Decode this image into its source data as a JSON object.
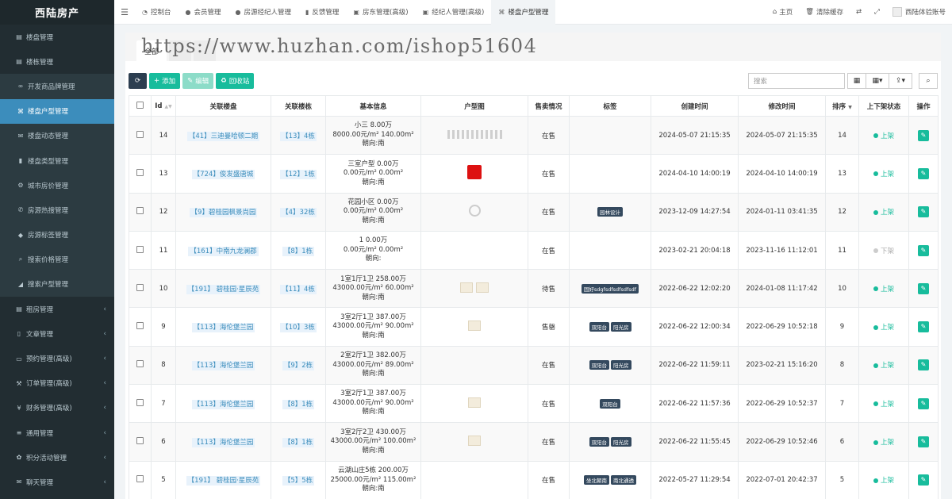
{
  "brand": "西陆房产",
  "sidebar": {
    "items": [
      {
        "label": "楼盘管理",
        "icon": "building-icon",
        "sub": false,
        "active": false,
        "caret": false
      },
      {
        "label": "楼栋管理",
        "icon": "building-icon",
        "sub": false,
        "active": false,
        "caret": false
      },
      {
        "label": "开发商品牌管理",
        "icon": "link-icon",
        "sub": true,
        "active": false,
        "caret": false
      },
      {
        "label": "楼盘户型管理",
        "icon": "sitemap-icon",
        "sub": true,
        "active": true,
        "caret": false
      },
      {
        "label": "楼盘动态管理",
        "icon": "comments-icon",
        "sub": true,
        "active": false,
        "caret": false
      },
      {
        "label": "楼盘类型管理",
        "icon": "book-icon",
        "sub": true,
        "active": false,
        "caret": false
      },
      {
        "label": "城市房价管理",
        "icon": "gear-icon",
        "sub": true,
        "active": false,
        "caret": false
      },
      {
        "label": "房源热搜管理",
        "icon": "bullhorn-icon",
        "sub": true,
        "active": false,
        "caret": false
      },
      {
        "label": "房源标签管理",
        "icon": "tags-icon",
        "sub": true,
        "active": false,
        "caret": false
      },
      {
        "label": "搜索价格管理",
        "icon": "search-icon",
        "sub": true,
        "active": false,
        "caret": false
      },
      {
        "label": "搜索户型管理",
        "icon": "chart-icon",
        "sub": true,
        "active": false,
        "caret": false
      },
      {
        "label": "租房管理",
        "icon": "building-icon",
        "sub": false,
        "active": false,
        "caret": true
      },
      {
        "label": "文章管理",
        "icon": "file-icon",
        "sub": false,
        "active": false,
        "caret": true
      },
      {
        "label": "预约管理(高级)",
        "icon": "monitor-icon",
        "sub": false,
        "active": false,
        "caret": true
      },
      {
        "label": "订单管理(高级)",
        "icon": "gavel-icon",
        "sub": false,
        "active": false,
        "caret": true
      },
      {
        "label": "财务管理(高级)",
        "icon": "yen-icon",
        "sub": false,
        "active": false,
        "caret": true
      },
      {
        "label": "通用管理",
        "icon": "list-icon",
        "sub": false,
        "active": false,
        "caret": true
      },
      {
        "label": "积分活动管理",
        "icon": "gift-icon",
        "sub": false,
        "active": false,
        "caret": true
      },
      {
        "label": "聊天管理",
        "icon": "chat-icon",
        "sub": false,
        "active": false,
        "caret": true
      }
    ]
  },
  "topnav": {
    "tabs": [
      {
        "label": "控制台",
        "icon": "dashboard-icon",
        "active": false
      },
      {
        "label": "会员管理",
        "icon": "user-icon",
        "active": false
      },
      {
        "label": "房源经纪人管理",
        "icon": "user-icon",
        "active": false
      },
      {
        "label": "反馈管理",
        "icon": "book-icon",
        "active": false
      },
      {
        "label": "房东管理(高级)",
        "icon": "lock-icon",
        "active": false
      },
      {
        "label": "经纪人管理(高级)",
        "icon": "lock-icon",
        "active": false
      },
      {
        "label": "楼盘户型管理",
        "icon": "sitemap-icon",
        "active": true
      }
    ],
    "home": "主页",
    "clear_cache": "清除缓存",
    "user": "西陆体验账号"
  },
  "watermark": "https://www.huzhan.com/ishop51604",
  "subtabs": [
    "全部",
    "",
    ""
  ],
  "toolbar": {
    "add": "添加",
    "edit": "编辑",
    "trash": "回收站",
    "search_placeholder": "搜索"
  },
  "table": {
    "headers": {
      "id": "Id",
      "loupan": "关联楼盘",
      "loudong": "关联楼栋",
      "info": "基本信息",
      "image": "户型图",
      "sale": "售卖情况",
      "tags": "标签",
      "created": "创建时间",
      "updated": "修改时间",
      "weigh": "排序",
      "status": "上下架状态",
      "op": "操作"
    },
    "rows": [
      {
        "id": "14",
        "loupan": "【41】三迪曼哈顿二期",
        "loudong": "【13】4栋",
        "info1": "小三 8.00万",
        "info2": "8000.00元/m² 140.00m²",
        "info3": "朝向:南",
        "image": "strip",
        "sale": "在售",
        "sale_color": "normal",
        "tags": [],
        "created": "2024-05-07 21:15:35",
        "updated": "2024-05-07 21:15:35",
        "weigh": "14",
        "status": "上架",
        "status_on": true
      },
      {
        "id": "13",
        "loupan": "【724】俊发盛唐城",
        "loudong": "【12】1栋",
        "info1": "三室户型 0.00万",
        "info2": "0.00元/m² 0.00m²",
        "info3": "朝向:南",
        "image": "red",
        "sale": "在售",
        "sale_color": "normal",
        "tags": [],
        "created": "2024-04-10 14:00:19",
        "updated": "2024-04-10 14:00:19",
        "weigh": "13",
        "status": "上架",
        "status_on": true
      },
      {
        "id": "12",
        "loupan": "【9】碧桂园枫景尚园",
        "loudong": "【4】32栋",
        "info1": "花园小区 0.00万",
        "info2": "0.00元/m² 0.00m²",
        "info3": "朝向:南",
        "image": "ring",
        "sale": "在售",
        "sale_color": "normal",
        "tags": [
          "园林设计"
        ],
        "created": "2023-12-09 14:27:54",
        "updated": "2024-01-11 03:41:35",
        "weigh": "12",
        "status": "上架",
        "status_on": true
      },
      {
        "id": "11",
        "loupan": "【161】中南九龙澜郡",
        "loudong": "【8】1栋",
        "info1": "1 0.00万",
        "info2": "0.00元/m² 0.00m²",
        "info3": "朝向:",
        "image": "none",
        "sale": "在售",
        "sale_color": "normal",
        "tags": [],
        "created": "2023-02-21 20:04:18",
        "updated": "2023-11-16 11:12:01",
        "weigh": "11",
        "status": "下架",
        "status_on": false
      },
      {
        "id": "10",
        "loupan": "【191】 碧桂园·星辰苑",
        "loudong": "【11】4栋",
        "info1": "1室1厅1卫 258.00万",
        "info2": "43000.00元/m² 60.00m²",
        "info3": "朝向:南",
        "image": "double",
        "sale": "待售",
        "sale_color": "red",
        "tags": [
          "固好sdgfsdfsdfsdfsdf"
        ],
        "created": "2022-06-22 12:02:20",
        "updated": "2024-01-08 11:17:42",
        "weigh": "10",
        "status": "上架",
        "status_on": true
      },
      {
        "id": "9",
        "loupan": "【113】海伦堡兰园",
        "loudong": "【10】3栋",
        "info1": "3室2厅1卫 387.00万",
        "info2": "43000.00元/m² 90.00m²",
        "info3": "朝向:南",
        "image": "single",
        "sale": "售罄",
        "sale_color": "green",
        "tags": [
          "双阳台",
          "阳光房"
        ],
        "created": "2022-06-22 12:00:34",
        "updated": "2022-06-29 10:52:18",
        "weigh": "9",
        "status": "上架",
        "status_on": true
      },
      {
        "id": "8",
        "loupan": "【113】海伦堡兰园",
        "loudong": "【9】2栋",
        "info1": "2室2厅1卫 382.00万",
        "info2": "43000.00元/m² 89.00m²",
        "info3": "朝向:南",
        "image": "none",
        "sale": "在售",
        "sale_color": "normal",
        "tags": [
          "双阳台",
          "阳光房"
        ],
        "created": "2022-06-22 11:59:11",
        "updated": "2023-02-21 15:16:20",
        "weigh": "8",
        "status": "上架",
        "status_on": true
      },
      {
        "id": "7",
        "loupan": "【113】海伦堡兰园",
        "loudong": "【8】1栋",
        "info1": "3室2厅1卫 387.00万",
        "info2": "43000.00元/m² 90.00m²",
        "info3": "朝向:南",
        "image": "single",
        "sale": "在售",
        "sale_color": "normal",
        "tags": [
          "双阳台"
        ],
        "created": "2022-06-22 11:57:36",
        "updated": "2022-06-29 10:52:37",
        "weigh": "7",
        "status": "上架",
        "status_on": true
      },
      {
        "id": "6",
        "loupan": "【113】海伦堡兰园",
        "loudong": "【8】1栋",
        "info1": "3室2厅2卫 430.00万",
        "info2": "43000.00元/m² 100.00m²",
        "info3": "朝向:南",
        "image": "single",
        "sale": "在售",
        "sale_color": "normal",
        "tags": [
          "双阳台",
          "阳光房"
        ],
        "created": "2022-06-22 11:55:45",
        "updated": "2022-06-29 10:52:46",
        "weigh": "6",
        "status": "上架",
        "status_on": true
      },
      {
        "id": "5",
        "loupan": "【191】 碧桂园·星辰苑",
        "loudong": "【5】5栋",
        "info1": "云湖山庄5栋 200.00万",
        "info2": "25000.00元/m² 115.00m²",
        "info3": "朝向:南",
        "image": "none",
        "sale": "在售",
        "sale_color": "normal",
        "tags": [
          "坐北朝南",
          "南北通透"
        ],
        "created": "2022-05-27 11:29:54",
        "updated": "2022-07-01 20:42:37",
        "weigh": "5",
        "status": "上架",
        "status_on": true
      }
    ]
  }
}
